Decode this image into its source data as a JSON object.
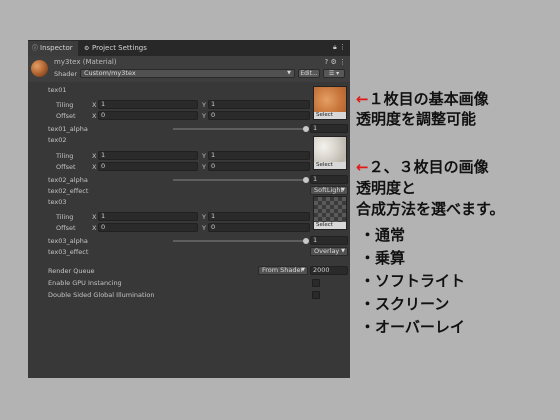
{
  "tabs": [
    {
      "label": "Inspector",
      "icon": "info-icon"
    },
    {
      "label": "Project Settings",
      "icon": "gear-icon"
    }
  ],
  "material": {
    "name": "my3tex (Material)",
    "shader_label": "Shader",
    "shader_value": "Custom/my3tex",
    "edit_label": "Edit...",
    "list_icon": "list-icon"
  },
  "tex01": {
    "header": "tex01",
    "tiling_label": "Tiling",
    "offset_label": "Offset",
    "tiling_x": "1",
    "tiling_y": "1",
    "offset_x": "0",
    "offset_y": "0",
    "alpha_label": "tex01_alpha",
    "alpha_value": "1",
    "alpha_fraction": 1.0,
    "select_label": "Select"
  },
  "tex02": {
    "header": "tex02",
    "tiling_label": "Tiling",
    "offset_label": "Offset",
    "tiling_x": "1",
    "tiling_y": "1",
    "offset_x": "0",
    "offset_y": "0",
    "alpha_label": "tex02_alpha",
    "alpha_value": "1",
    "alpha_fraction": 1.0,
    "effect_label": "tex02_effect",
    "effect_value": "SoftLight",
    "select_label": "Select"
  },
  "tex03": {
    "header": "tex03",
    "tiling_label": "Tiling",
    "offset_label": "Offset",
    "tiling_x": "1",
    "tiling_y": "1",
    "offset_x": "0",
    "offset_y": "0",
    "alpha_label": "tex03_alpha",
    "alpha_value": "1",
    "alpha_fraction": 1.0,
    "effect_label": "tex03_effect",
    "effect_value": "Overlay",
    "select_label": "Select"
  },
  "axes": {
    "x": "X",
    "y": "Y"
  },
  "render_queue": {
    "label": "Render Queue",
    "mode": "From Shader",
    "value": "2000"
  },
  "gpu_instancing": {
    "label": "Enable GPU Instancing",
    "checked": false
  },
  "double_sided": {
    "label": "Double Sided Global Illumination",
    "checked": false
  },
  "annotations": {
    "a1_arrow": "←",
    "a1_line1": "１枚目の基本画像",
    "a1_line2": "透明度を調整可能",
    "a2_arrow": "←",
    "a2_line1": "２、３枚目の画像",
    "a2_line2": "透明度と",
    "a2_line3": "合成方法を選べます。",
    "modes": [
      "・通常",
      "・乗算",
      "・ソフトライト",
      "・スクリーン",
      "・オーバーレイ"
    ]
  },
  "colors": {
    "panel_bg": "#383838",
    "page_bg": "#b3b3b3",
    "annotation_arrow": "#e01818"
  }
}
